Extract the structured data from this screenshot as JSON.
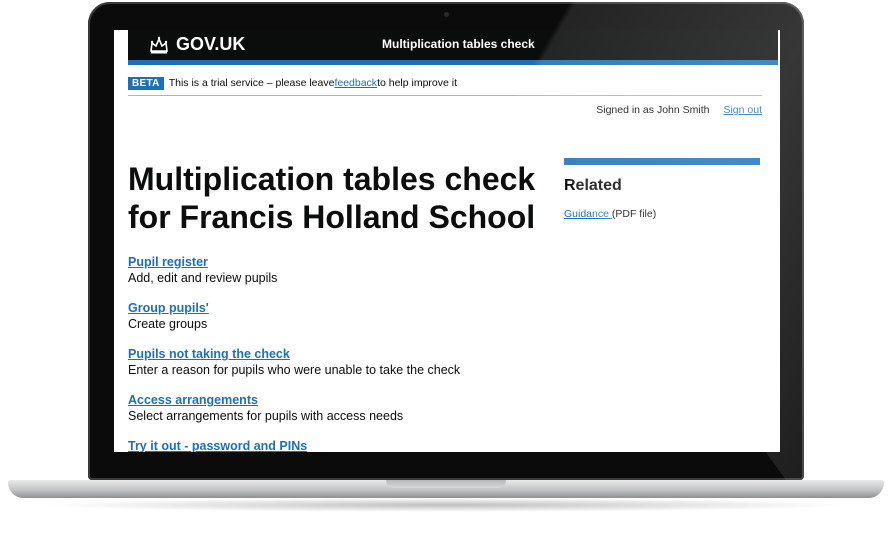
{
  "header": {
    "logo_text": "GOV.UK",
    "service_name": "Multiplication tables check"
  },
  "phase_banner": {
    "tag": "BETA",
    "text_before": "This is a trial service – please leave ",
    "link": "feedback",
    "text_after": " to help improve it"
  },
  "account": {
    "signed_in_text": "Signed in as John Smith",
    "sign_out": "Sign out"
  },
  "page_title": "Multiplication tables check for Francis Holland School",
  "related": {
    "heading": "Related",
    "link": "Guidance ",
    "note": "(PDF file)"
  },
  "tasks": [
    {
      "title": "Pupil register",
      "description": "Add, edit and review pupils"
    },
    {
      "title": "Group pupils'",
      "description": "Create groups"
    },
    {
      "title": "Pupils not taking the check",
      "description": "Enter a reason for pupils who were unable to take the check"
    },
    {
      "title": "Access arrangements",
      "description": "Select arrangements for pupils with access needs"
    },
    {
      "title": "Try it out - password and PINs",
      "description": ""
    }
  ],
  "colors": {
    "header_bg": "#0b0c0c",
    "brand_blue": "#1d70b8",
    "text": "#0b0c0c"
  }
}
